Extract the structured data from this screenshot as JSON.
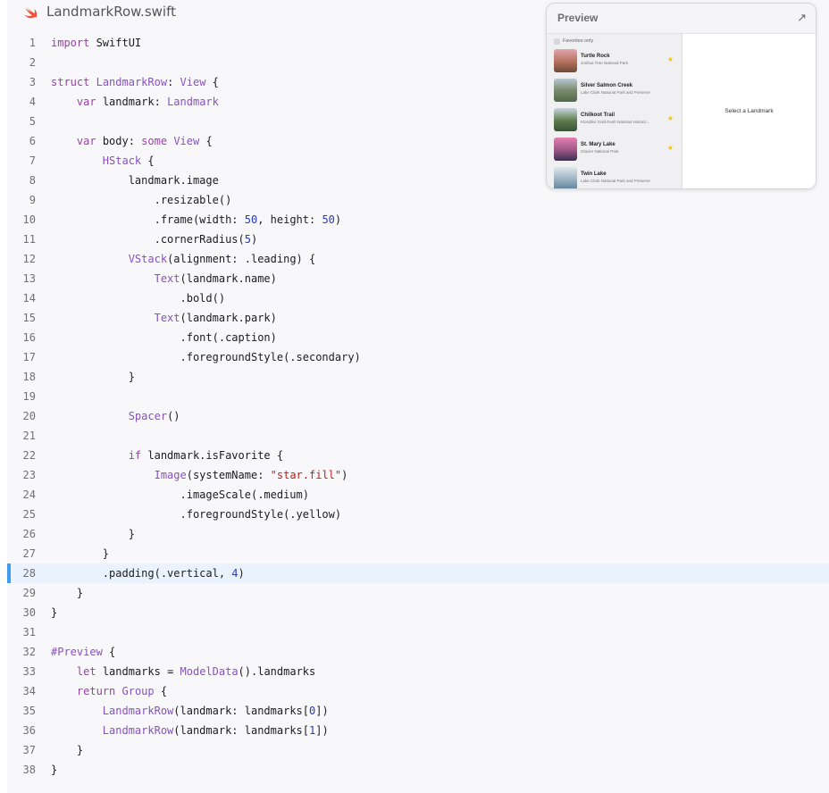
{
  "file": {
    "name": "LandmarkRow.swift"
  },
  "code_lines": [
    {
      "n": "1",
      "t": "import SwiftUI"
    },
    {
      "n": "2",
      "t": ""
    },
    {
      "n": "3",
      "t": "struct LandmarkRow: View {"
    },
    {
      "n": "4",
      "t": "    var landmark: Landmark"
    },
    {
      "n": "5",
      "t": ""
    },
    {
      "n": "6",
      "t": "    var body: some View {"
    },
    {
      "n": "7",
      "t": "        HStack {"
    },
    {
      "n": "8",
      "t": "            landmark.image"
    },
    {
      "n": "9",
      "t": "                .resizable()"
    },
    {
      "n": "10",
      "t": "                .frame(width: 50, height: 50)"
    },
    {
      "n": "11",
      "t": "                .cornerRadius(5)"
    },
    {
      "n": "12",
      "t": "            VStack(alignment: .leading) {"
    },
    {
      "n": "13",
      "t": "                Text(landmark.name)"
    },
    {
      "n": "14",
      "t": "                    .bold()"
    },
    {
      "n": "15",
      "t": "                Text(landmark.park)"
    },
    {
      "n": "16",
      "t": "                    .font(.caption)"
    },
    {
      "n": "17",
      "t": "                    .foregroundStyle(.secondary)"
    },
    {
      "n": "18",
      "t": "            }"
    },
    {
      "n": "19",
      "t": ""
    },
    {
      "n": "20",
      "t": "            Spacer()"
    },
    {
      "n": "21",
      "t": ""
    },
    {
      "n": "22",
      "t": "            if landmark.isFavorite {"
    },
    {
      "n": "23",
      "t": "                Image(systemName: \"star.fill\")"
    },
    {
      "n": "24",
      "t": "                    .imageScale(.medium)"
    },
    {
      "n": "25",
      "t": "                    .foregroundStyle(.yellow)"
    },
    {
      "n": "26",
      "t": "            }"
    },
    {
      "n": "27",
      "t": "        }"
    },
    {
      "n": "28",
      "t": "        .padding(.vertical, 4)"
    },
    {
      "n": "29",
      "t": "    }"
    },
    {
      "n": "30",
      "t": "}"
    },
    {
      "n": "31",
      "t": ""
    },
    {
      "n": "32",
      "t": "#Preview {"
    },
    {
      "n": "33",
      "t": "    let landmarks = ModelData().landmarks"
    },
    {
      "n": "34",
      "t": "    return Group {"
    },
    {
      "n": "35",
      "t": "        LandmarkRow(landmark: landmarks[0])"
    },
    {
      "n": "36",
      "t": "        LandmarkRow(landmark: landmarks[1])"
    },
    {
      "n": "37",
      "t": "    }"
    },
    {
      "n": "38",
      "t": "}"
    }
  ],
  "highlighted_line": "28",
  "preview": {
    "title": "Preview",
    "expand_icon": "↗",
    "favorites_label": "Favorites only",
    "detail_placeholder": "Select a Landmark",
    "star": "★",
    "rows": [
      {
        "name": "Turtle Rock",
        "park": "Joshua Tree National Park",
        "favorite": true
      },
      {
        "name": "Silver Salmon Creek",
        "park": "Lake Clark National Park and Preserve",
        "favorite": false
      },
      {
        "name": "Chilkoot Trail",
        "park": "Klondike Gold Rush National Historic...",
        "favorite": true
      },
      {
        "name": "St. Mary Lake",
        "park": "Glacier National Park",
        "favorite": true
      },
      {
        "name": "Twin Lake",
        "park": "Lake Clark National Park and Preserve",
        "favorite": false
      }
    ]
  },
  "colors": {
    "highlight_bar": "#3d9bf0",
    "keyword": "#9b3ea8",
    "number": "#2437c7",
    "string": "#c41a16",
    "star": "#f5c400"
  }
}
